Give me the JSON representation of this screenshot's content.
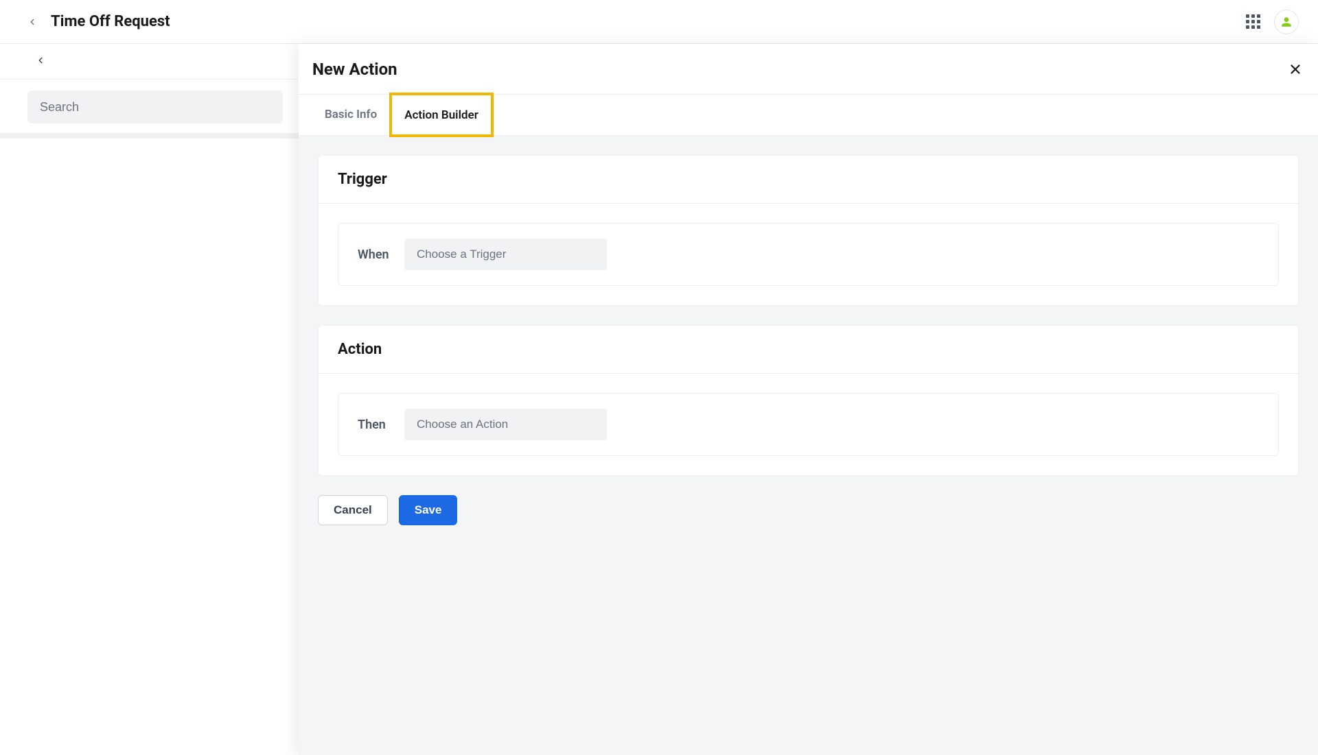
{
  "header": {
    "title": "Time Off Request"
  },
  "sidebar": {
    "search_placeholder": "Search"
  },
  "slideover": {
    "title": "New Action",
    "tabs": [
      {
        "label": "Basic Info"
      },
      {
        "label": "Action Builder"
      }
    ],
    "trigger_card": {
      "title": "Trigger",
      "when_label": "When",
      "when_placeholder": "Choose a Trigger"
    },
    "action_card": {
      "title": "Action",
      "then_label": "Then",
      "then_placeholder": "Choose an Action"
    },
    "buttons": {
      "cancel": "Cancel",
      "save": "Save"
    }
  }
}
